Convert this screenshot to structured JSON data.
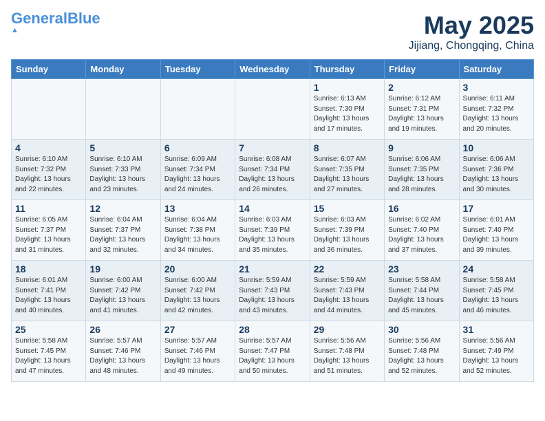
{
  "header": {
    "logo_general": "General",
    "logo_blue": "Blue",
    "month": "May 2025",
    "location": "Jijiang, Chongqing, China"
  },
  "weekdays": [
    "Sunday",
    "Monday",
    "Tuesday",
    "Wednesday",
    "Thursday",
    "Friday",
    "Saturday"
  ],
  "weeks": [
    [
      {
        "day": "",
        "info": ""
      },
      {
        "day": "",
        "info": ""
      },
      {
        "day": "",
        "info": ""
      },
      {
        "day": "",
        "info": ""
      },
      {
        "day": "1",
        "info": "Sunrise: 6:13 AM\nSunset: 7:30 PM\nDaylight: 13 hours\nand 17 minutes."
      },
      {
        "day": "2",
        "info": "Sunrise: 6:12 AM\nSunset: 7:31 PM\nDaylight: 13 hours\nand 19 minutes."
      },
      {
        "day": "3",
        "info": "Sunrise: 6:11 AM\nSunset: 7:32 PM\nDaylight: 13 hours\nand 20 minutes."
      }
    ],
    [
      {
        "day": "4",
        "info": "Sunrise: 6:10 AM\nSunset: 7:32 PM\nDaylight: 13 hours\nand 22 minutes."
      },
      {
        "day": "5",
        "info": "Sunrise: 6:10 AM\nSunset: 7:33 PM\nDaylight: 13 hours\nand 23 minutes."
      },
      {
        "day": "6",
        "info": "Sunrise: 6:09 AM\nSunset: 7:34 PM\nDaylight: 13 hours\nand 24 minutes."
      },
      {
        "day": "7",
        "info": "Sunrise: 6:08 AM\nSunset: 7:34 PM\nDaylight: 13 hours\nand 26 minutes."
      },
      {
        "day": "8",
        "info": "Sunrise: 6:07 AM\nSunset: 7:35 PM\nDaylight: 13 hours\nand 27 minutes."
      },
      {
        "day": "9",
        "info": "Sunrise: 6:06 AM\nSunset: 7:35 PM\nDaylight: 13 hours\nand 28 minutes."
      },
      {
        "day": "10",
        "info": "Sunrise: 6:06 AM\nSunset: 7:36 PM\nDaylight: 13 hours\nand 30 minutes."
      }
    ],
    [
      {
        "day": "11",
        "info": "Sunrise: 6:05 AM\nSunset: 7:37 PM\nDaylight: 13 hours\nand 31 minutes."
      },
      {
        "day": "12",
        "info": "Sunrise: 6:04 AM\nSunset: 7:37 PM\nDaylight: 13 hours\nand 32 minutes."
      },
      {
        "day": "13",
        "info": "Sunrise: 6:04 AM\nSunset: 7:38 PM\nDaylight: 13 hours\nand 34 minutes."
      },
      {
        "day": "14",
        "info": "Sunrise: 6:03 AM\nSunset: 7:39 PM\nDaylight: 13 hours\nand 35 minutes."
      },
      {
        "day": "15",
        "info": "Sunrise: 6:03 AM\nSunset: 7:39 PM\nDaylight: 13 hours\nand 36 minutes."
      },
      {
        "day": "16",
        "info": "Sunrise: 6:02 AM\nSunset: 7:40 PM\nDaylight: 13 hours\nand 37 minutes."
      },
      {
        "day": "17",
        "info": "Sunrise: 6:01 AM\nSunset: 7:40 PM\nDaylight: 13 hours\nand 39 minutes."
      }
    ],
    [
      {
        "day": "18",
        "info": "Sunrise: 6:01 AM\nSunset: 7:41 PM\nDaylight: 13 hours\nand 40 minutes."
      },
      {
        "day": "19",
        "info": "Sunrise: 6:00 AM\nSunset: 7:42 PM\nDaylight: 13 hours\nand 41 minutes."
      },
      {
        "day": "20",
        "info": "Sunrise: 6:00 AM\nSunset: 7:42 PM\nDaylight: 13 hours\nand 42 minutes."
      },
      {
        "day": "21",
        "info": "Sunrise: 5:59 AM\nSunset: 7:43 PM\nDaylight: 13 hours\nand 43 minutes."
      },
      {
        "day": "22",
        "info": "Sunrise: 5:59 AM\nSunset: 7:43 PM\nDaylight: 13 hours\nand 44 minutes."
      },
      {
        "day": "23",
        "info": "Sunrise: 5:58 AM\nSunset: 7:44 PM\nDaylight: 13 hours\nand 45 minutes."
      },
      {
        "day": "24",
        "info": "Sunrise: 5:58 AM\nSunset: 7:45 PM\nDaylight: 13 hours\nand 46 minutes."
      }
    ],
    [
      {
        "day": "25",
        "info": "Sunrise: 5:58 AM\nSunset: 7:45 PM\nDaylight: 13 hours\nand 47 minutes."
      },
      {
        "day": "26",
        "info": "Sunrise: 5:57 AM\nSunset: 7:46 PM\nDaylight: 13 hours\nand 48 minutes."
      },
      {
        "day": "27",
        "info": "Sunrise: 5:57 AM\nSunset: 7:46 PM\nDaylight: 13 hours\nand 49 minutes."
      },
      {
        "day": "28",
        "info": "Sunrise: 5:57 AM\nSunset: 7:47 PM\nDaylight: 13 hours\nand 50 minutes."
      },
      {
        "day": "29",
        "info": "Sunrise: 5:56 AM\nSunset: 7:48 PM\nDaylight: 13 hours\nand 51 minutes."
      },
      {
        "day": "30",
        "info": "Sunrise: 5:56 AM\nSunset: 7:48 PM\nDaylight: 13 hours\nand 52 minutes."
      },
      {
        "day": "31",
        "info": "Sunrise: 5:56 AM\nSunset: 7:49 PM\nDaylight: 13 hours\nand 52 minutes."
      }
    ]
  ]
}
